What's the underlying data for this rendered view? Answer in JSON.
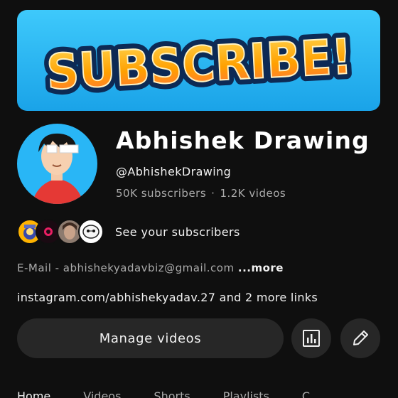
{
  "banner": {
    "text": "SUBSCRIBE!"
  },
  "channel": {
    "name": "Abhishek Drawing",
    "handle": "@AbhishekDrawing",
    "subscribers": "50K subscribers",
    "separator": "·",
    "videos": "1.2K videos"
  },
  "subscribers_row": {
    "label": "See your subscribers"
  },
  "description": {
    "text": "E-Mail - abhishekyadavbiz@gmail.com",
    "more": "...more"
  },
  "links": {
    "text": "instagram.com/abhishekyadav.27 and 2 more links"
  },
  "actions": {
    "manage_label": "Manage videos",
    "analytics_icon": "analytics-icon",
    "edit_icon": "edit-icon"
  },
  "tabs": [
    "Home",
    "Videos",
    "Shorts",
    "Playlists",
    "C"
  ],
  "colors": {
    "background": "#0f0f0f",
    "button": "#272727",
    "banner_sky": "#29b6f6",
    "banner_text": "#ffa726"
  }
}
